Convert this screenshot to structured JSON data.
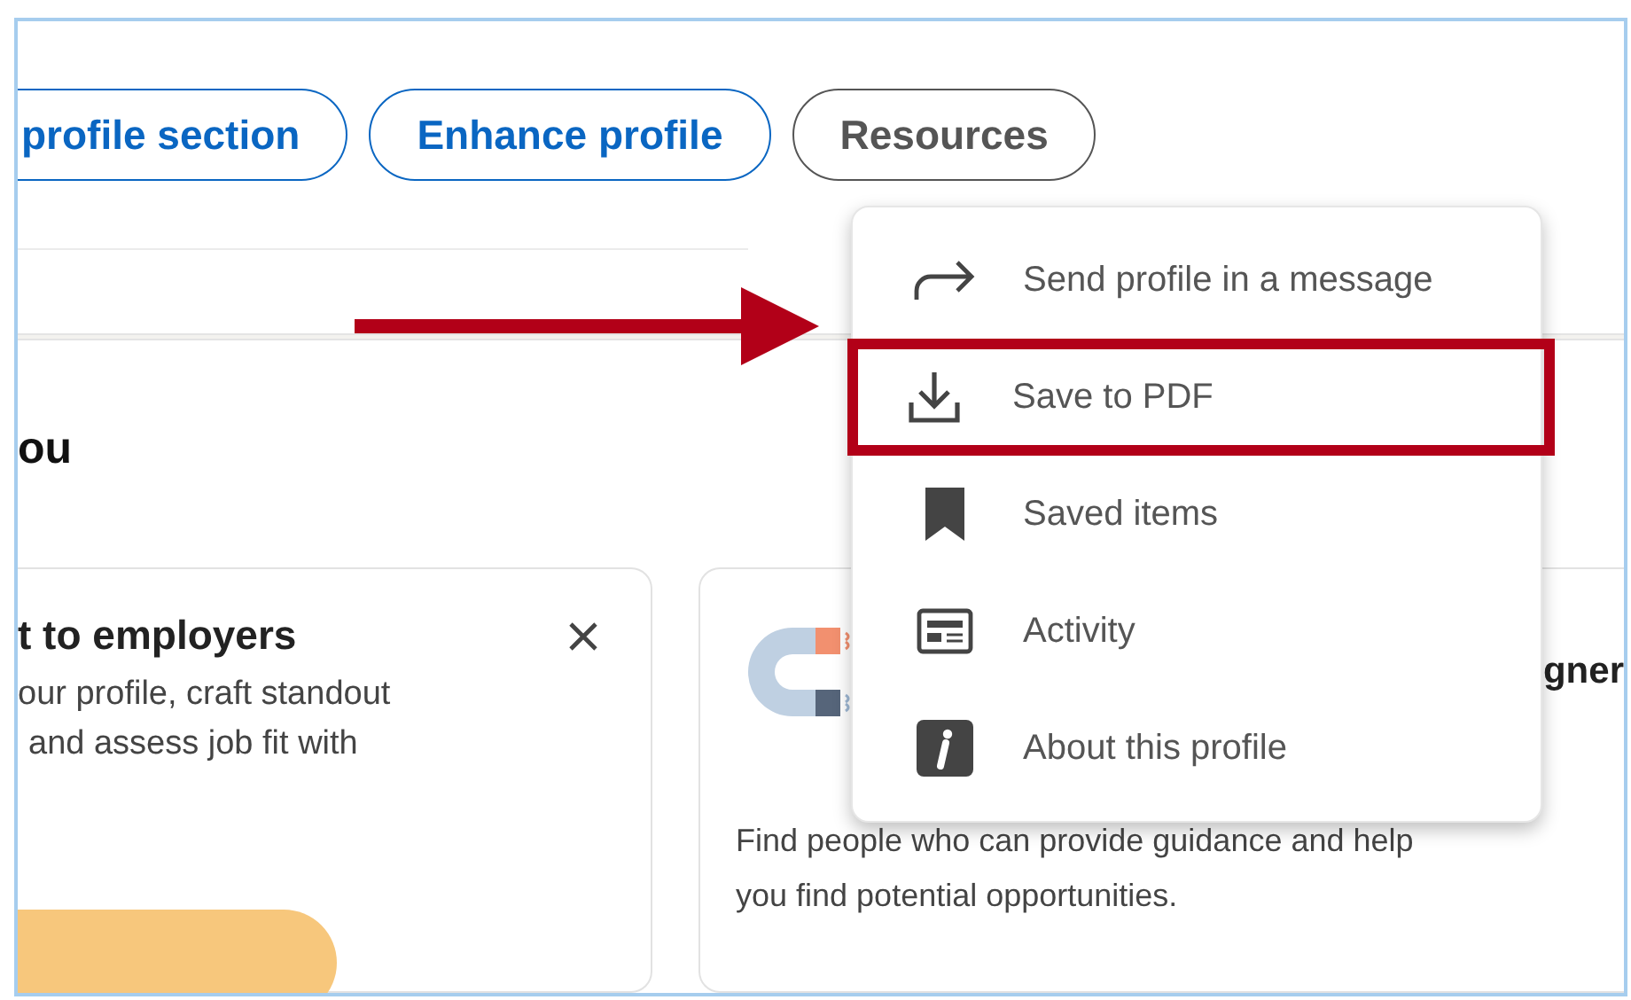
{
  "actions": [
    {
      "label": "profile section",
      "kind": "primary"
    },
    {
      "label": "Enhance profile",
      "kind": "primary"
    },
    {
      "label": "Resources",
      "kind": "secondary"
    }
  ],
  "section": {
    "heading": "ou"
  },
  "cards": [
    {
      "kind": "promo",
      "title": "t to employers",
      "lines": [
        "our profile, craft standout",
        "and assess job fit with"
      ]
    },
    {
      "kind": "mentor",
      "title": "gner",
      "lines": [
        "Find people who can provide guidance and help",
        "you find potential opportunities."
      ]
    }
  ],
  "menu": {
    "items": [
      {
        "label": "Send profile in a message",
        "highlighted": false
      },
      {
        "label": "Save to PDF",
        "highlighted": true
      },
      {
        "label": "Saved items",
        "highlighted": false
      },
      {
        "label": "Activity",
        "highlighted": false
      },
      {
        "label": "About this profile",
        "highlighted": false
      }
    ]
  }
}
